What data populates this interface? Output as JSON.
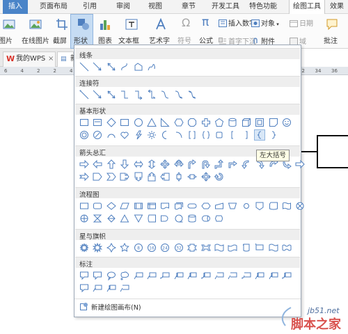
{
  "ribbon_tabs": [
    "插入",
    "页面布局",
    "引用",
    "审阅",
    "视图",
    "章节",
    "开发工具",
    "特色功能",
    "绘图工具",
    "效果"
  ],
  "ribbon": {
    "picture_label": "图片",
    "online_picture_label": "在线图片",
    "screenshot_label": "截屏",
    "shape_label": "形状",
    "chart_label": "图表",
    "textbox_label": "文本框",
    "wordart_label": "艺术字",
    "symbol_label": "符号",
    "formula_label": "公式",
    "insert_number_label": "插入数字",
    "object_label": "对象",
    "date_label": "日期",
    "dropcap_label": "首字下沉",
    "attachment_label": "附件",
    "field_label": "域",
    "comment_label": "批注"
  },
  "doc_tabs": {
    "home_label": "我的WPS",
    "doc_label": "新"
  },
  "ruler_numbers": [
    "6",
    "4",
    "2",
    "2",
    "4",
    "6",
    "8",
    "10",
    "12",
    "14",
    "16",
    "18",
    "20",
    "22",
    "24",
    "26",
    "28",
    "30",
    "32",
    "34",
    "36"
  ],
  "panel": {
    "categories": [
      "线条",
      "连接符",
      "基本形状",
      "箭头总汇",
      "流程图",
      "星与旗帜",
      "标注"
    ],
    "new_canvas_label": "新建绘图画布(N)"
  },
  "tooltip": "左大括号",
  "watermark": {
    "url": "jb51.net",
    "name": "脚本之家"
  },
  "colors": {
    "accent": "#4a84c8",
    "shape_blue": "#4f7fbf",
    "watermark_red": "#d9534f"
  }
}
